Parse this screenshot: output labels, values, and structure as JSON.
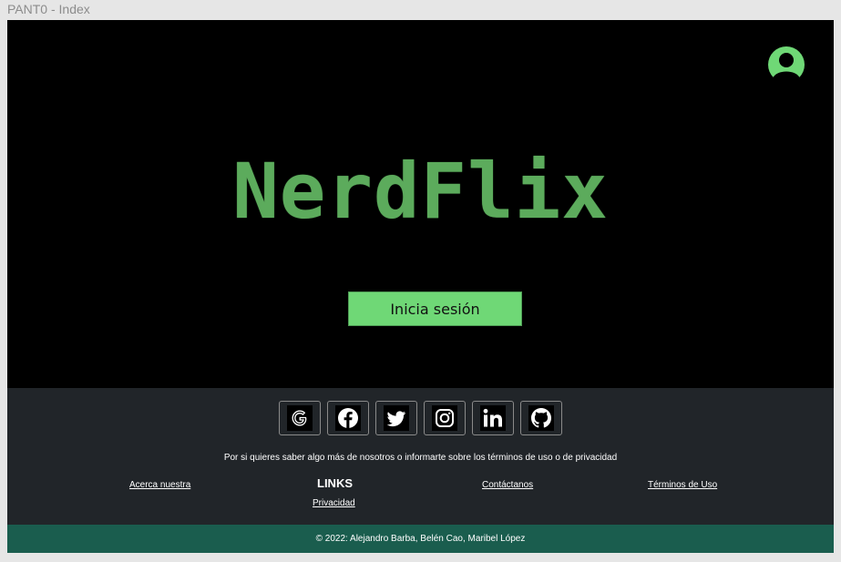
{
  "window": {
    "title": "PANT0 - Index"
  },
  "header": {
    "avatar_icon": "user-avatar-icon",
    "accent_color": "#6fd876"
  },
  "hero": {
    "logo_text": "NerdFlix",
    "logo_color": "#5cab5c",
    "login_button": "Inicia sesión"
  },
  "footer": {
    "socials": [
      {
        "icon": "google-icon"
      },
      {
        "icon": "facebook-icon"
      },
      {
        "icon": "twitter-icon"
      },
      {
        "icon": "instagram-icon"
      },
      {
        "icon": "linkedin-icon"
      },
      {
        "icon": "github-icon"
      }
    ],
    "info_text": "Por si quieres saber algo más de nosotros o informarte sobre los términos de uso o de privacidad",
    "links_title": "LINKS",
    "links": {
      "about": "Acerca nuestra",
      "privacy": "Privacidad",
      "contact": "Contáctanos",
      "terms": "Términos de Uso"
    },
    "copyright": "© 2022: Alejandro Barba, Belén Cao, Maribel López",
    "bg_color": "#212529",
    "copyright_bg_color": "#1a5d4e"
  }
}
